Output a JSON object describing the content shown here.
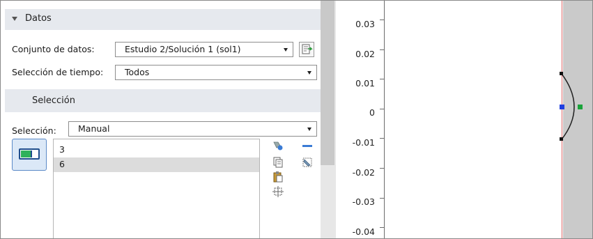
{
  "datos": {
    "title": "Datos",
    "dataset_label": "Conjunto de datos:",
    "dataset_value": "Estudio 2/Solución 1 (sol1)",
    "time_label": "Selección de tiempo:",
    "time_value": "Todos"
  },
  "seleccion": {
    "title": "Selección",
    "label": "Selección:",
    "value": "Manual",
    "items": [
      {
        "label": "3",
        "selected": false
      },
      {
        "label": "6",
        "selected": true
      }
    ]
  },
  "plot": {
    "ticks": [
      "0.03",
      "0.02",
      "0.01",
      "0",
      "-0.01",
      "-0.02",
      "-0.03",
      "-0.04"
    ],
    "colors": {
      "axis": "#6b6b6b",
      "red_line": "#dd6666",
      "blue_point": "#1f3fe0",
      "green_point": "#1aa33a",
      "gray_region": "#cacaca"
    }
  },
  "icons": [
    "collapse-triangle-icon",
    "dataset-settings-icon",
    "active-toggle-icon",
    "add-to-selection-icon",
    "remove-from-selection-icon",
    "copy-selection-icon",
    "clear-selection-icon",
    "paste-selection-icon",
    "zoom-to-selection-icon"
  ]
}
